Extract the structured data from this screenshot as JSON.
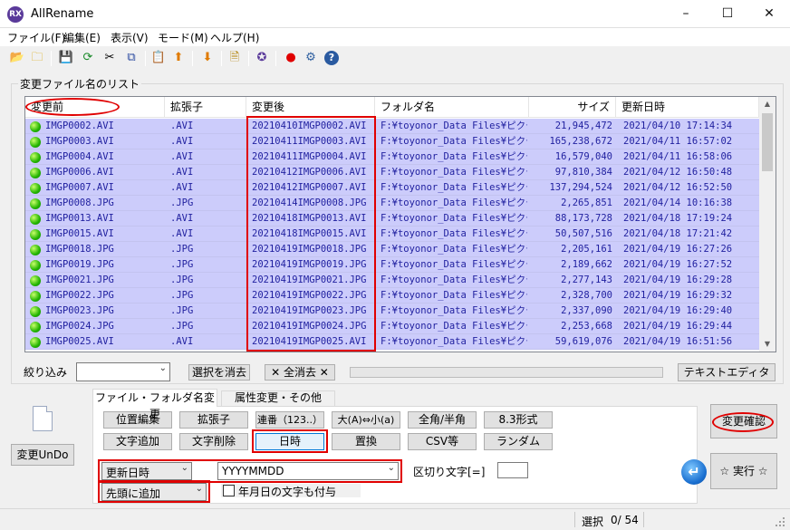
{
  "window": {
    "title": "AllRename",
    "icon_text": "RX",
    "minimize": "–",
    "maximize": "☐",
    "close": "✕"
  },
  "menu": [
    "ファイル(F)",
    "編集(E)",
    "表示(V)",
    "モード(M)",
    "ヘルプ(H)"
  ],
  "toolbar_icons": [
    {
      "name": "folder-open-icon",
      "glyph": "📂"
    },
    {
      "name": "folder-refresh-icon",
      "glyph": "🗀"
    },
    {
      "name": "save-icon",
      "glyph": "💾"
    },
    {
      "name": "refresh-icon",
      "glyph": "⟳"
    },
    {
      "name": "cut-icon",
      "glyph": "✂"
    },
    {
      "name": "copy-icon",
      "glyph": "⧉"
    },
    {
      "name": "paste-icon",
      "glyph": "📋"
    },
    {
      "name": "move-up-icon",
      "glyph": "⬆"
    },
    {
      "name": "move-down-icon",
      "glyph": "⬇"
    },
    {
      "name": "document-icon",
      "glyph": "🗎"
    },
    {
      "name": "app-logo-icon",
      "glyph": "✪"
    },
    {
      "name": "record-icon",
      "glyph": "●"
    },
    {
      "name": "settings-icon",
      "glyph": "⚙"
    },
    {
      "name": "help-icon",
      "glyph": "?"
    }
  ],
  "list_group_label": "変更ファイル名のリスト",
  "columns": [
    "変更前",
    "拡張子",
    "変更後",
    "フォルダ名",
    "サイズ",
    "更新日時"
  ],
  "rows": [
    [
      "IMGP0002.AVI",
      ".AVI",
      "20210410IMGP0002.AVI",
      "F:¥toyonor_Data Files¥ピクチャ...",
      "21,945,472",
      "2021/04/10 17:14:34"
    ],
    [
      "IMGP0003.AVI",
      ".AVI",
      "20210411IMGP0003.AVI",
      "F:¥toyonor_Data Files¥ピクチャ...",
      "165,238,672",
      "2021/04/11 16:57:02"
    ],
    [
      "IMGP0004.AVI",
      ".AVI",
      "20210411IMGP0004.AVI",
      "F:¥toyonor_Data Files¥ピクチャ...",
      "16,579,040",
      "2021/04/11 16:58:06"
    ],
    [
      "IMGP0006.AVI",
      ".AVI",
      "20210412IMGP0006.AVI",
      "F:¥toyonor_Data Files¥ピクチャ...",
      "97,810,384",
      "2021/04/12 16:50:48"
    ],
    [
      "IMGP0007.AVI",
      ".AVI",
      "20210412IMGP0007.AVI",
      "F:¥toyonor_Data Files¥ピクチャ...",
      "137,294,524",
      "2021/04/12 16:52:50"
    ],
    [
      "IMGP0008.JPG",
      ".JPG",
      "20210414IMGP0008.JPG",
      "F:¥toyonor_Data Files¥ピクチャ...",
      "2,265,851",
      "2021/04/14 10:16:38"
    ],
    [
      "IMGP0013.AVI",
      ".AVI",
      "20210418IMGP0013.AVI",
      "F:¥toyonor_Data Files¥ピクチャ...",
      "88,173,728",
      "2021/04/18 17:19:24"
    ],
    [
      "IMGP0015.AVI",
      ".AVI",
      "20210418IMGP0015.AVI",
      "F:¥toyonor_Data Files¥ピクチャ...",
      "50,507,516",
      "2021/04/18 17:21:42"
    ],
    [
      "IMGP0018.JPG",
      ".JPG",
      "20210419IMGP0018.JPG",
      "F:¥toyonor_Data Files¥ピクチャ...",
      "2,205,161",
      "2021/04/19 16:27:26"
    ],
    [
      "IMGP0019.JPG",
      ".JPG",
      "20210419IMGP0019.JPG",
      "F:¥toyonor_Data Files¥ピクチャ...",
      "2,189,662",
      "2021/04/19 16:27:52"
    ],
    [
      "IMGP0021.JPG",
      ".JPG",
      "20210419IMGP0021.JPG",
      "F:¥toyonor_Data Files¥ピクチャ...",
      "2,277,143",
      "2021/04/19 16:29:28"
    ],
    [
      "IMGP0022.JPG",
      ".JPG",
      "20210419IMGP0022.JPG",
      "F:¥toyonor_Data Files¥ピクチャ...",
      "2,328,700",
      "2021/04/19 16:29:32"
    ],
    [
      "IMGP0023.JPG",
      ".JPG",
      "20210419IMGP0023.JPG",
      "F:¥toyonor_Data Files¥ピクチャ...",
      "2,337,090",
      "2021/04/19 16:29:40"
    ],
    [
      "IMGP0024.JPG",
      ".JPG",
      "20210419IMGP0024.JPG",
      "F:¥toyonor_Data Files¥ピクチャ...",
      "2,253,668",
      "2021/04/19 16:29:44"
    ],
    [
      "IMGP0025.AVI",
      ".AVI",
      "20210419IMGP0025.AVI",
      "F:¥toyonor_Data Files¥ピクチャ...",
      "59,619,076",
      "2021/04/19 16:51:56"
    ]
  ],
  "filter": {
    "label": "絞り込み",
    "value": "",
    "clear_selection": "選択を消去",
    "clear_all": "✕ 全消去 ✕",
    "text_editor": "テキストエディタ"
  },
  "tabs": [
    "ファイル・フォルダ名変更",
    "属性変更・その他"
  ],
  "buttons_row1": [
    "位置編集",
    "拡張子",
    "連番（123..）",
    "大(A)⇔小(a)",
    "全角/半角",
    "8.3形式"
  ],
  "buttons_row2": [
    "文字追加",
    "文字削除",
    "日時",
    "置換",
    "CSV等",
    "ランダム"
  ],
  "options": {
    "date_source": "更新日時",
    "format": "YYYYMMDD",
    "separator_label": "区切り文字[=]",
    "separator_value": "",
    "position": "先頭に追加",
    "also_date_text": "年月日の文字も付与"
  },
  "left_panel": {
    "undo": "変更UnDo"
  },
  "right_panel": {
    "confirm": "変更確認",
    "execute": "☆ 実行 ☆"
  },
  "status": {
    "selection_label": "選択",
    "selection_value": "0/ 54"
  },
  "colors": {
    "row_bg": "#ccccfb",
    "row_text": "#1f1f9f",
    "highlight": "#e00000",
    "accent": "#0078d7"
  }
}
